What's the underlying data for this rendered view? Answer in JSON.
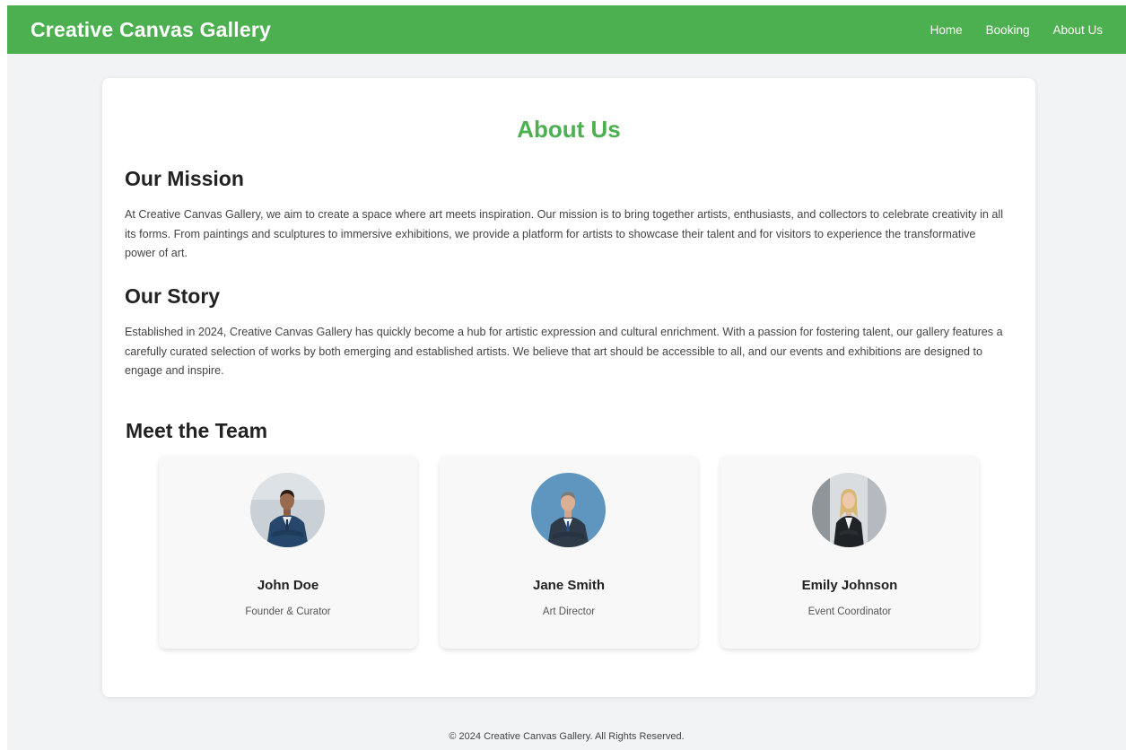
{
  "header": {
    "brand": "Creative Canvas Gallery",
    "nav": [
      "Home",
      "Booking",
      "About Us"
    ]
  },
  "about": {
    "title": "About Us",
    "mission_heading": "Our Mission",
    "mission_text": "At Creative Canvas Gallery, we aim to create a space where art meets inspiration. Our mission is to bring together artists, enthusiasts, and collectors to celebrate creativity in all its forms. From paintings and sculptures to immersive exhibitions, we provide a platform for artists to showcase their talent and for visitors to experience the transformative power of art.",
    "story_heading": "Our Story",
    "story_text": "Established in 2024, Creative Canvas Gallery has quickly become a hub for artistic expression and cultural enrichment. With a passion for fostering talent, our gallery features a carefully curated selection of works by both emerging and established artists. We believe that art should be accessible to all, and our events and exhibitions are designed to engage and inspire.",
    "team_heading": "Meet the Team"
  },
  "team": [
    {
      "name": "John Doe",
      "role": "Founder & Curator"
    },
    {
      "name": "Jane Smith",
      "role": "Art Director"
    },
    {
      "name": "Emily Johnson",
      "role": "Event Coordinator"
    }
  ],
  "footer": {
    "text": "© 2024 Creative Canvas Gallery. All Rights Reserved."
  },
  "colors": {
    "accent": "#4caf50",
    "page_background": "#f2f3f4",
    "card_background": "#ffffff"
  }
}
